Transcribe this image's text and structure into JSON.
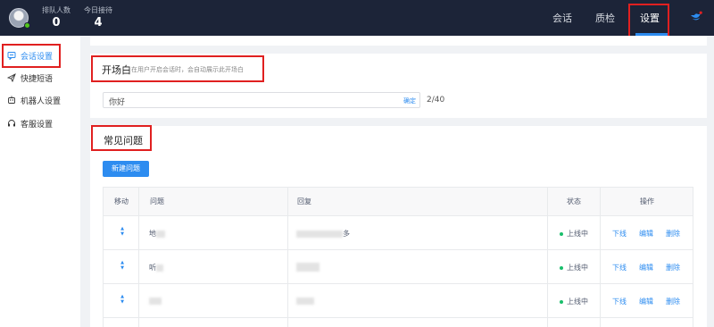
{
  "header": {
    "stats": [
      {
        "label": "排队人数",
        "value": "0"
      },
      {
        "label": "今日接待",
        "value": "4"
      }
    ],
    "nav": [
      "会话",
      "质检",
      "设置"
    ],
    "active_nav": "设置",
    "icons": {
      "avatar": "avatar-icon",
      "bird": "bird-icon"
    },
    "accent": "#2d8cf0",
    "bg": "#1c2438"
  },
  "sidebar": {
    "items": [
      {
        "label": "会话设置",
        "icon": "conversation-settings-icon",
        "active": true
      },
      {
        "label": "快捷短语",
        "icon": "paper-plane-icon"
      },
      {
        "label": "机器人设置",
        "icon": "robot-icon"
      },
      {
        "label": "客服设置",
        "icon": "headset-icon"
      }
    ]
  },
  "opening": {
    "title": "开场白",
    "subtitle": "在用户开启会话时，会自动展示此开场白",
    "input_value": "你好",
    "confirm_label": "确定",
    "counter": "2/40"
  },
  "faq": {
    "title": "常见问题",
    "new_button": "新建问题",
    "columns": [
      "移动",
      "问题",
      "回复",
      "状态",
      "操作"
    ],
    "rows": [
      {
        "question": "地",
        "reply": "多",
        "status": "上线中",
        "actions": [
          "下线",
          "编辑",
          "删除"
        ]
      },
      {
        "question": "听",
        "reply": "",
        "status": "上线中",
        "actions": [
          "下线",
          "编辑",
          "删除"
        ]
      },
      {
        "question": "",
        "reply": "",
        "status": "上线中",
        "actions": [
          "下线",
          "编辑",
          "删除"
        ]
      }
    ]
  }
}
